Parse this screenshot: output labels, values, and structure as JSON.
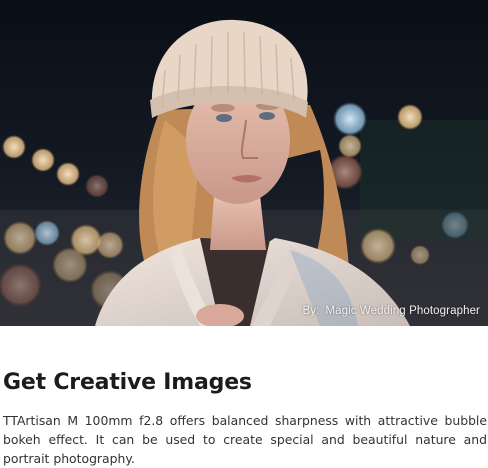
{
  "photo": {
    "alt": "",
    "credit_prefix": "By:",
    "credit_name": "Magic Wedding Photographer"
  },
  "section": {
    "heading": "Get Creative Images",
    "paragraph": "TTArtisan M 100mm f2.8 offers balanced sharpness with attractive bubble bokeh effect. It can be used to create special and beautiful nature and portrait photography."
  }
}
